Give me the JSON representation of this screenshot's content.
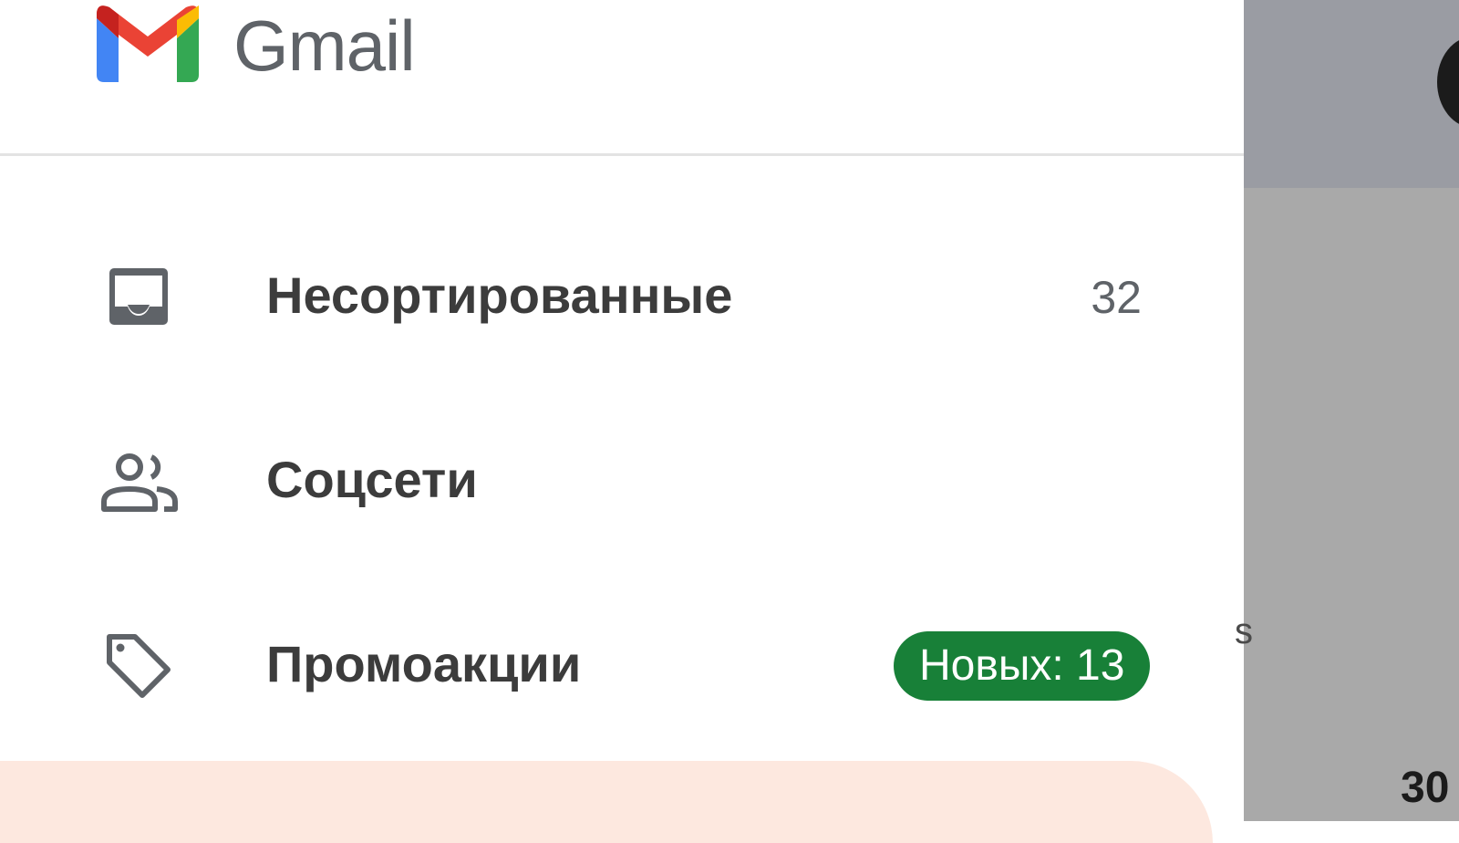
{
  "app": {
    "brand": "Gmail"
  },
  "nav": [
    {
      "label": "Несортированные",
      "count": "32",
      "icon": "inbox-icon"
    },
    {
      "label": "Соцсети",
      "count": "",
      "icon": "people-icon"
    },
    {
      "label": "Промоакции",
      "badge": "Новых: 13",
      "icon": "tag-icon"
    }
  ],
  "background_pane": {
    "peek_text": "30",
    "peek_fragment": "s"
  },
  "colors": {
    "badge_green": "#188038",
    "active_highlight": "#fde8df",
    "icon_gray": "#5f6368",
    "label_text": "#3c3c3c"
  }
}
